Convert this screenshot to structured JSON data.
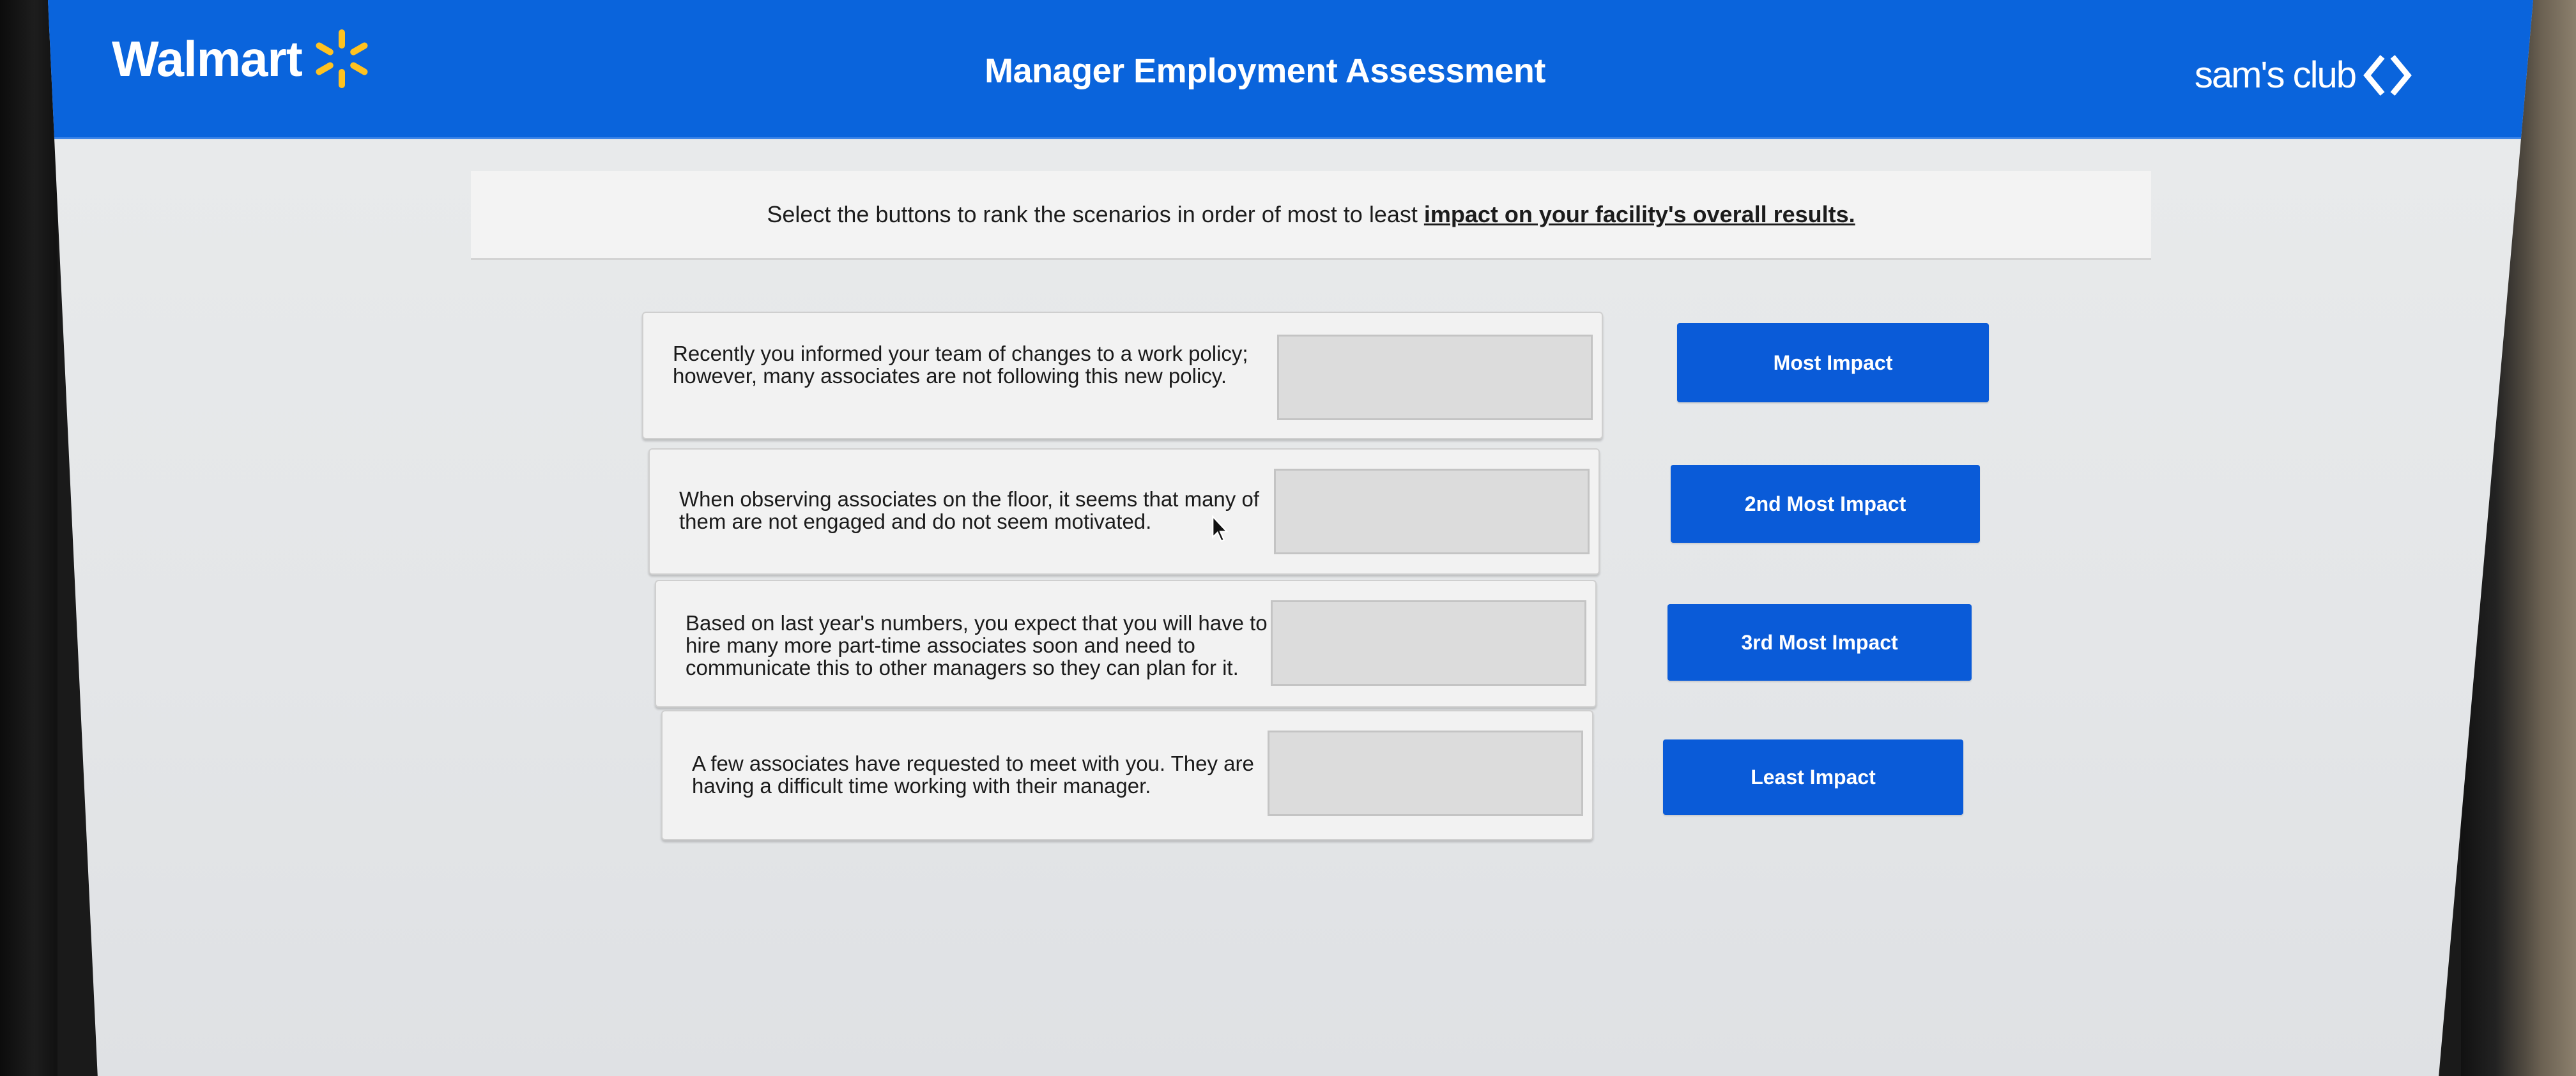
{
  "header": {
    "walmart_logo_text": "Walmart",
    "title": "Manager Employment Assessment",
    "sams_logo_text": "sam's club",
    "brand_blue": "#0a64dc",
    "spark_color": "#ffc220"
  },
  "instructions": {
    "prefix": "Select the buttons to rank the scenarios in order of most to least",
    "emphasis": "impact on your facility's overall results."
  },
  "scenarios": [
    {
      "text": "Recently you informed your team of changes to a work policy; however, many associates are not following this new policy.",
      "selected_rank": ""
    },
    {
      "text": "When observing associates on the floor, it seems that many of them are not engaged and do not seem motivated.",
      "selected_rank": ""
    },
    {
      "text": "Based on last year's numbers, you expect that you will have to hire many more part-time associates soon and need to communicate this to other managers so they can plan for it.",
      "selected_rank": ""
    },
    {
      "text": "A few associates have requested to meet with you. They are having a difficult time working with their manager.",
      "selected_rank": ""
    }
  ],
  "rank_buttons": [
    {
      "label": "Most Impact"
    },
    {
      "label": "2nd Most Impact"
    },
    {
      "label": "3rd Most Impact"
    },
    {
      "label": "Least Impact"
    }
  ],
  "button_color": "#0a5bd8"
}
